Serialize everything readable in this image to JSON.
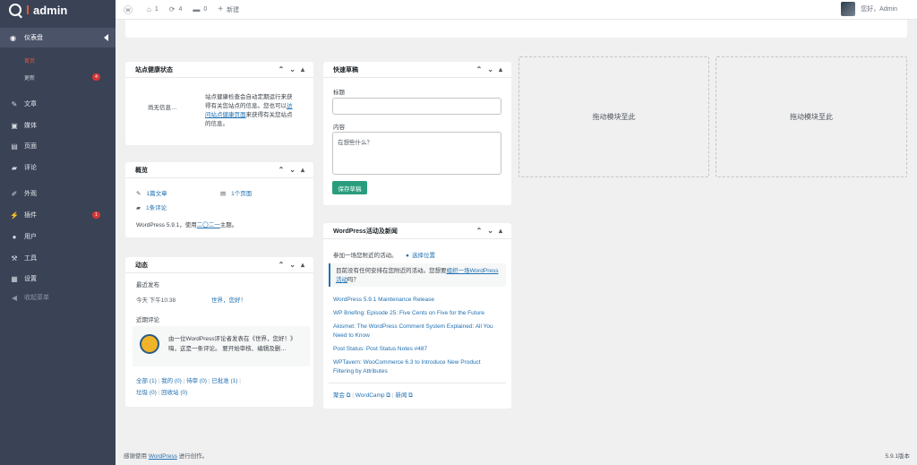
{
  "brand": {
    "title": "admin"
  },
  "sidebar": {
    "dashboard_label": "仪表盘",
    "sub_home": "首页",
    "sub_updates": "更新",
    "updates_badge": "4",
    "items": [
      {
        "label": "文章",
        "icon": "pin-icon"
      },
      {
        "label": "媒体",
        "icon": "media-icon"
      },
      {
        "label": "页面",
        "icon": "page-icon"
      },
      {
        "label": "评论",
        "icon": "comment-icon"
      },
      {
        "label": "外观",
        "icon": "brush-icon"
      },
      {
        "label": "插件",
        "icon": "plugin-icon"
      },
      {
        "label": "用户",
        "icon": "user-icon"
      },
      {
        "label": "工具",
        "icon": "wrench-icon"
      },
      {
        "label": "设置",
        "icon": "settings-icon"
      },
      {
        "label": "收起菜单",
        "icon": "collapse-icon"
      }
    ],
    "plugins_badge": "1"
  },
  "topbar": {
    "home_count": "1",
    "updates_count": "4",
    "comments_count": "0",
    "new_label": "新建",
    "greeting": "您好，Admin"
  },
  "health": {
    "title": "站点健康状态",
    "no_info": "尚无信息…",
    "desc_line1": "站点健康检查会自动定期运行来获",
    "desc_line2": "得有关您站点的信息。您也可以",
    "desc_link1": "访",
    "desc_link2": "问站点健康页面",
    "desc_line3": "来获得有关您站点",
    "desc_line4": "的信息。"
  },
  "overview": {
    "title": "概览",
    "posts": "1篇文章",
    "pages": "1个页面",
    "comments": "1条评论",
    "wp_prefix": "WordPress 5.9.1，使用",
    "theme_link": "二〇二一",
    "wp_suffix": "主题。"
  },
  "activity": {
    "title": "动态",
    "recent_published": "最近发布",
    "pub_time": "今天 下午10:38",
    "pub_title": "世界，您好！",
    "recent_comments": "近期评论",
    "comment_line1": "由一位WordPress评论者发表在《世界，您好！》",
    "comment_line2": "嗨，这是一条评论。 要开始审核、编辑及删…",
    "filters": [
      "全部 (1)",
      "我的 (0)",
      "待审 (0)",
      "已批准 (1)",
      "垃圾 (0)",
      "回收站 (0)"
    ]
  },
  "quickdraft": {
    "title": "快速草稿",
    "title_label": "标题",
    "content_label": "内容",
    "content_placeholder": "在想些什么？",
    "save_button": "保存草稿"
  },
  "events": {
    "title": "WordPress活动及新闻",
    "attend": "参加一场您附近的活动。",
    "select_location": "选择位置",
    "notice_text": "目前没有任何安排在您附近的活动。您想要",
    "notice_link": "组织一场WordPress活动",
    "notice_end": "吗？",
    "news": [
      "WordPress 5.9.1 Maintenance Release",
      "WP Briefing: Episode 25: Five Cents on Five for the Future",
      "Akismet: The WordPress Comment System Explained: All You",
      "Need to Know",
      "Post Status: Post Status Notes #487",
      "WPTavern: WooCommerce 6.3 to Introduce New Product",
      "Filtering by Attributes"
    ],
    "footer_links": [
      "聚会",
      "WordCamp",
      "新闻"
    ]
  },
  "dropzones": {
    "label1": "拖动模块至此",
    "label2": "拖动模块至此"
  },
  "footer": {
    "prefix": "感谢使用",
    "link": "WordPress",
    "suffix": "进行创作。",
    "version": "5.9.1版本"
  }
}
